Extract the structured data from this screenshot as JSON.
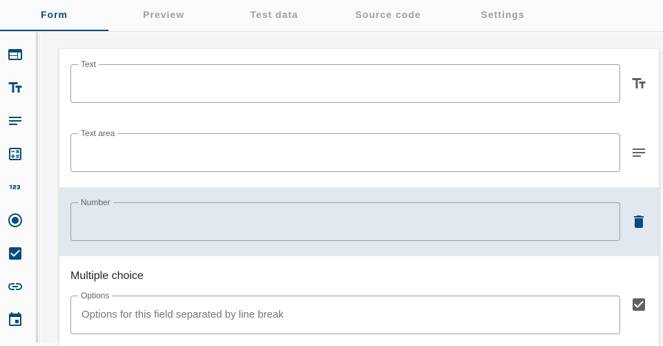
{
  "tabs": [
    {
      "label": "Form",
      "active": true
    },
    {
      "label": "Preview",
      "active": false
    },
    {
      "label": "Test data",
      "active": false
    },
    {
      "label": "Source code",
      "active": false
    },
    {
      "label": "Settings",
      "active": false
    }
  ],
  "toolbar": {
    "items": [
      {
        "icon": "web-layout-icon"
      },
      {
        "icon": "text-fields-icon"
      },
      {
        "icon": "notes-icon"
      },
      {
        "icon": "calculator-icon"
      },
      {
        "icon": "numbers-123-icon"
      },
      {
        "icon": "radio-button-icon"
      },
      {
        "icon": "checkbox-icon"
      },
      {
        "icon": "link-icon"
      },
      {
        "icon": "calendar-icon"
      }
    ]
  },
  "form": {
    "fields": [
      {
        "label": "Text",
        "value": "",
        "side_icon": "text-fields-icon"
      },
      {
        "label": "Text area",
        "value": "",
        "side_icon": "notes-icon"
      },
      {
        "label": "Number",
        "value": "",
        "side_icon": "delete-icon",
        "selected": true
      }
    ],
    "multiple_choice": {
      "title": "Multiple choice",
      "options_label": "Options",
      "options_placeholder": "Options for this field separated by line break",
      "side_icon": "checkbox-icon"
    }
  },
  "colors": {
    "accent": "#0b4a7a",
    "selected_row": "#e1e8f0",
    "muted_icon": "#616161"
  }
}
